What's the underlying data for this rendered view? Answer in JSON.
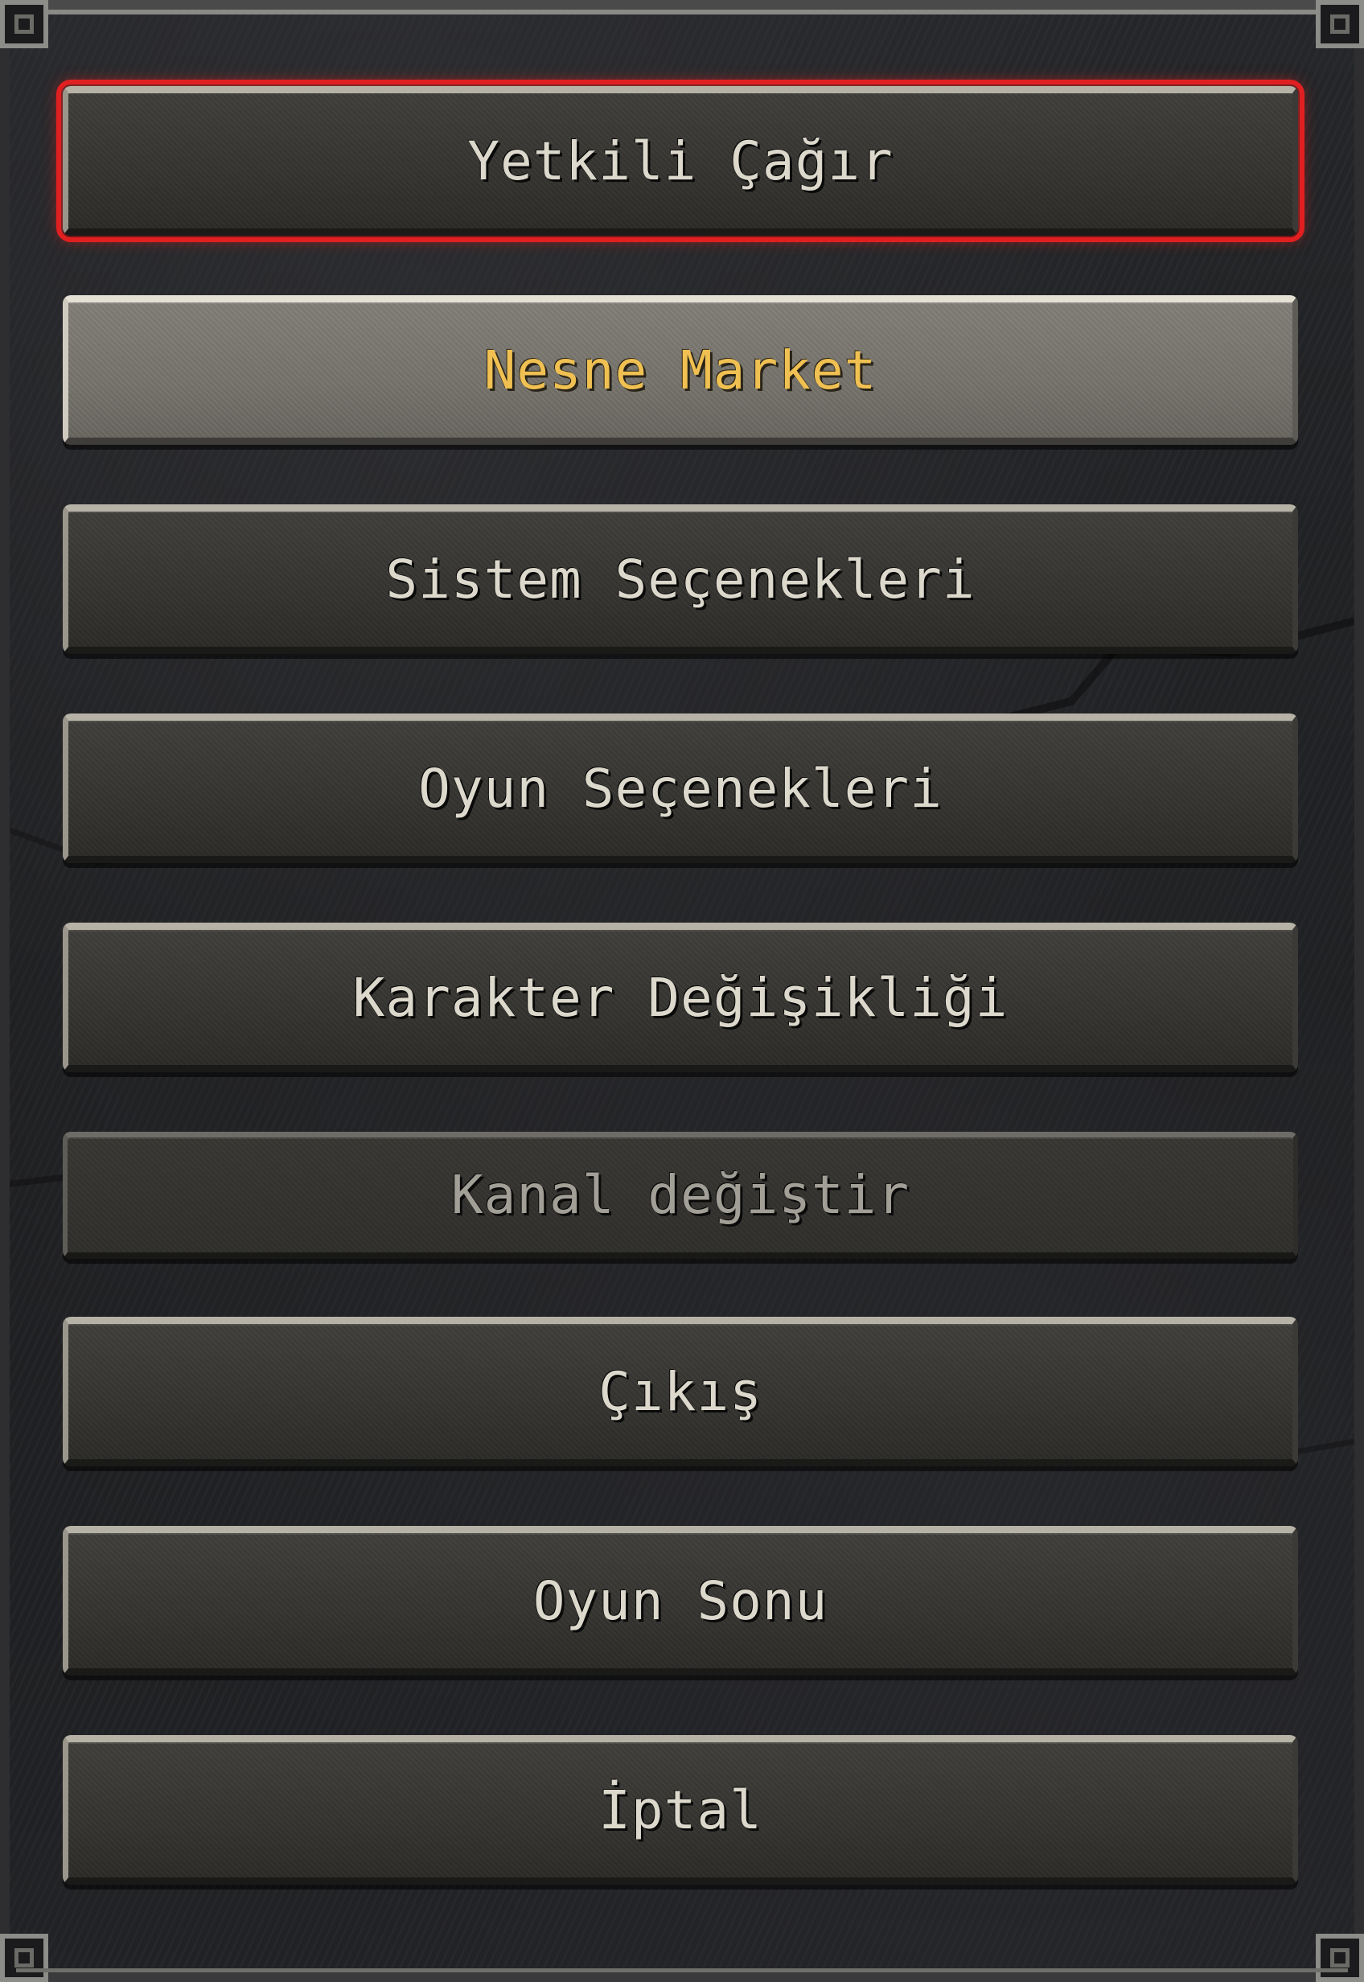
{
  "menu": {
    "items": [
      {
        "id": "call-gm",
        "label": "Yetkili Çağır",
        "state": "selected"
      },
      {
        "id": "item-shop",
        "label": "Nesne Market",
        "state": "highlight"
      },
      {
        "id": "system-options",
        "label": "Sistem Seçenekleri",
        "state": "normal"
      },
      {
        "id": "game-options",
        "label": "Oyun Seçenekleri",
        "state": "normal"
      },
      {
        "id": "change-character",
        "label": "Karakter Değişikliği",
        "state": "normal"
      },
      {
        "id": "change-channel",
        "label": "Kanal değiştir",
        "state": "disabled"
      },
      {
        "id": "logout",
        "label": "Çıkış",
        "state": "normal"
      },
      {
        "id": "quit-game",
        "label": "Oyun Sonu",
        "state": "normal"
      },
      {
        "id": "cancel",
        "label": "İptal",
        "state": "normal"
      }
    ]
  },
  "colors": {
    "highlight_text": "#f0c152",
    "normal_text": "#dcd8cc",
    "disabled_text": "#a29f97",
    "selected_outline": "#e02020"
  }
}
